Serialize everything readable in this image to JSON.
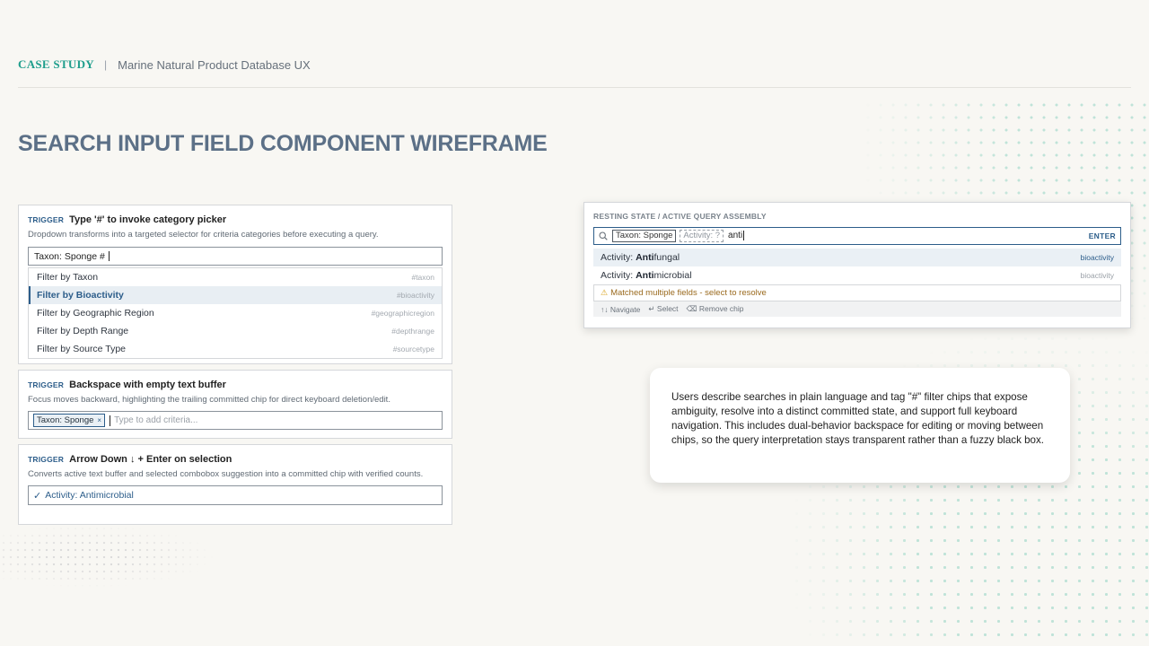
{
  "header": {
    "case_study": "CASE STUDY",
    "separator": "|",
    "project": "Marine Natural Product Database UX"
  },
  "page_title": "SEARCH INPUT FIELD COMPONENT WIREFRAME",
  "trigger1": {
    "tag": "TRIGGER",
    "title": "Type '#' to invoke category picker",
    "description": "Dropdown transforms into a targeted selector for criteria categories before executing a query.",
    "input_value": "Taxon: Sponge #",
    "options": [
      {
        "label": "Filter by Taxon",
        "tag": "#taxon"
      },
      {
        "label": "Filter by Bioactivity",
        "tag": "#bioactivity"
      },
      {
        "label": "Filter by Geographic Region",
        "tag": "#geographicregion"
      },
      {
        "label": "Filter by Depth Range",
        "tag": "#depthrange"
      },
      {
        "label": "Filter by Source Type",
        "tag": "#sourcetype"
      }
    ]
  },
  "trigger2": {
    "tag": "TRIGGER",
    "title": "Backspace with empty text buffer",
    "description": "Focus moves backward, highlighting the trailing committed chip for direct keyboard deletion/edit.",
    "chip_label": "Taxon: Sponge",
    "chip_remove": "×",
    "placeholder": "Type to add criteria..."
  },
  "trigger3": {
    "tag": "TRIGGER",
    "title": "Arrow Down ↓ + Enter on selection",
    "description": "Converts active text buffer and selected combobox suggestion into a committed chip with verified counts.",
    "check": "✓",
    "committed_label": "Activity: Antimicrobial"
  },
  "panel": {
    "label": "RESTING STATE / ACTIVE QUERY ASSEMBLY",
    "chip_committed": "Taxon: Sponge",
    "chip_pending": "Activity: ?",
    "typed_text": "anti",
    "enter_label": "ENTER",
    "suggestions": [
      {
        "prefix": "Activity: ",
        "match": "Anti",
        "rest": "fungal",
        "tag": "bioactivity"
      },
      {
        "prefix": "Activity: ",
        "match": "Anti",
        "rest": "microbial",
        "tag": "bioactivity"
      }
    ],
    "warning_icon": "⚠",
    "warning_text": "Matched multiple fields - select to resolve",
    "help": {
      "navigate": "↑↓ Navigate",
      "select": "↵ Select",
      "remove": "⌫ Remove chip"
    }
  },
  "description": "Users describe searches in plain language and tag \"#\" filter chips that expose ambiguity, resolve into a distinct committed state, and support full keyboard navigation. This includes dual-behavior backspace for editing or moving between chips, so the query interpretation stays transparent rather than a fuzzy black box.",
  "icons": {
    "search": "search-icon",
    "warning": "warning-icon",
    "check": "check-icon",
    "close": "close-icon"
  },
  "colors": {
    "background": "#f8f7f3",
    "accent_teal": "#1f9e8c",
    "accent_blue": "#2c5d8a",
    "title": "#5c7087",
    "warning": "#9a6a1e"
  }
}
